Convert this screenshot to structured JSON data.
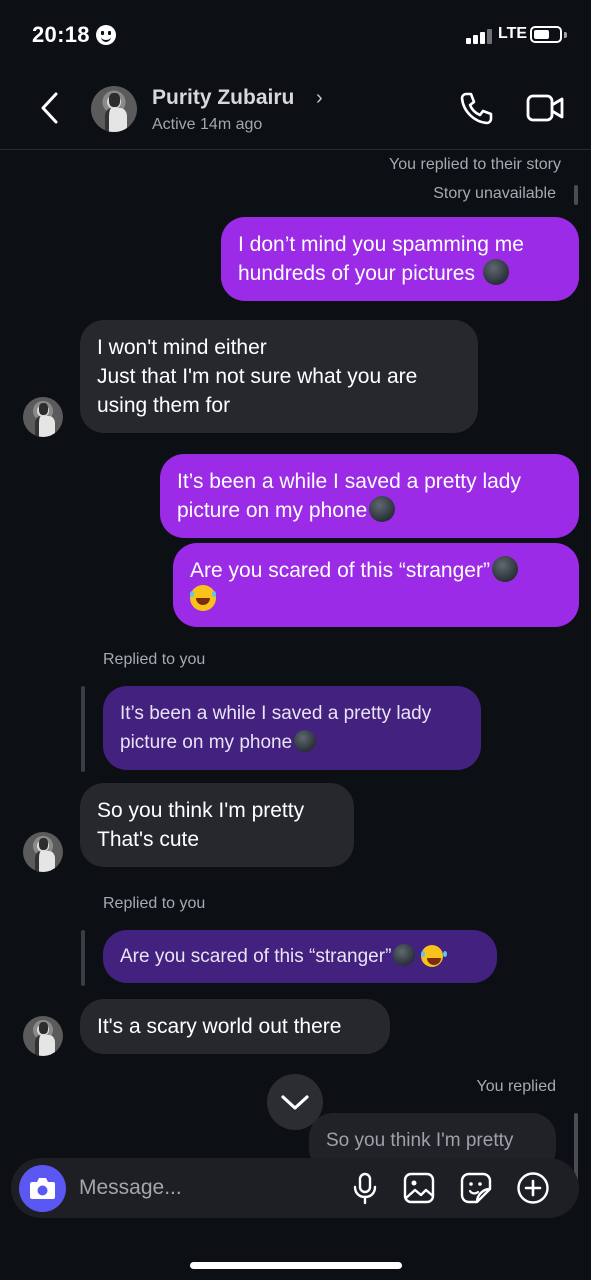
{
  "status_bar": {
    "time": "20:18",
    "network": "LTE"
  },
  "header": {
    "name": "Purity Zubairu",
    "chevron": "›",
    "status": "Active 14m ago"
  },
  "messages": {
    "story_reply_meta": "You replied to their story",
    "story_unavailable": "Story unavailable",
    "m1": "I don’t mind you spamming me hundreds of your pictures",
    "m2_line1": "I won't mind either",
    "m2_line2": "Just that I'm not sure what you are using them for",
    "m3": "It’s been a while I saved a pretty lady picture on my phone",
    "m4": "Are you scared of this “stranger”",
    "replied_to_you_1": "Replied to you",
    "quote1": "It’s been a while I saved a pretty lady picture on my phone",
    "m5_line1": "So you think I'm pretty",
    "m5_line2": "That's cute",
    "replied_to_you_2": "Replied to you",
    "quote2": "Are you scared of this “stranger”",
    "m6": "It's a scary world out there",
    "you_replied": "You replied",
    "quote3": "So you think I'm pretty"
  },
  "composer": {
    "placeholder": "Message..."
  },
  "icons": [
    "back-icon",
    "call-icon",
    "video-call-icon",
    "camera-icon",
    "microphone-icon",
    "gallery-icon",
    "sticker-icon",
    "add-icon",
    "chevron-down-icon"
  ],
  "colors": {
    "outgoing": "#9b2be6",
    "incoming": "#26282d",
    "reply_quote": "#43217f",
    "camera": "#5b57f3",
    "background": "#0c0f14"
  }
}
